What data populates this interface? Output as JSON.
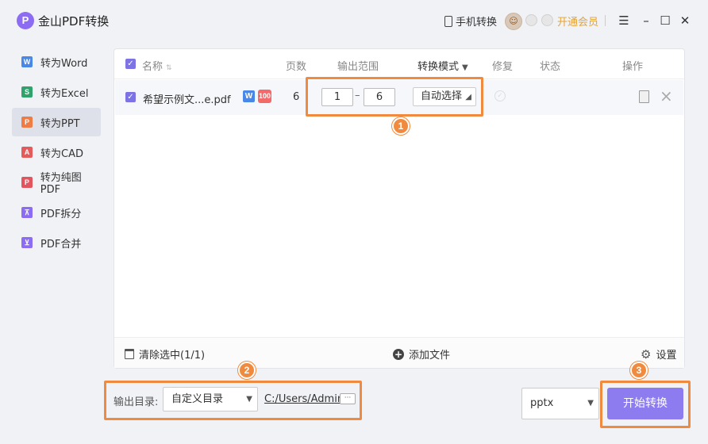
{
  "app": {
    "logo_text": "P",
    "title": "金山PDF转换"
  },
  "header": {
    "mobile_label": "手机转换",
    "vip_label": "开通会员"
  },
  "sidebar": {
    "items": [
      {
        "label": "转为Word",
        "icon_text": "W",
        "icon_color": "#4a88e8"
      },
      {
        "label": "转为Excel",
        "icon_text": "S",
        "icon_color": "#2fa36b"
      },
      {
        "label": "转为PPT",
        "icon_text": "P",
        "icon_color": "#ef7b45"
      },
      {
        "label": "转为CAD",
        "icon_text": "A",
        "icon_color": "#e55a5a"
      },
      {
        "label": "转为纯图PDF",
        "icon_text": "P",
        "icon_color": "#e2555f"
      },
      {
        "label": "PDF拆分",
        "icon_text": "⊼",
        "icon_color": "#8b6cf2"
      },
      {
        "label": "PDF合并",
        "icon_text": "⊻",
        "icon_color": "#8b6cf2"
      }
    ],
    "active_index": 2
  },
  "table": {
    "headers": {
      "name": "名称",
      "pages": "页数",
      "range": "输出范围",
      "mode": "转换模式",
      "repair": "修复",
      "status": "状态",
      "ops": "操作"
    },
    "rows": [
      {
        "filename": "希望示例文...e.pdf",
        "pages": "6",
        "range_from": "1",
        "range_to": "6",
        "range_sep": "–",
        "mode": "自动选择",
        "badge_w": "W",
        "badge_100": "100"
      }
    ]
  },
  "footer": {
    "clear_label": "清除选中(1/1)",
    "add_label": "添加文件",
    "settings_label": "设置"
  },
  "output": {
    "label": "输出目录:",
    "dir_option": "自定义目录",
    "path": "C:/Users/Admin",
    "more": "···"
  },
  "format": {
    "selected": "pptx"
  },
  "actions": {
    "start_label": "开始转换"
  },
  "markers": [
    "1",
    "2",
    "3"
  ],
  "colors": {
    "accent": "#8d7cf0",
    "highlight": "#f08a3e",
    "vip": "#e5a335"
  }
}
